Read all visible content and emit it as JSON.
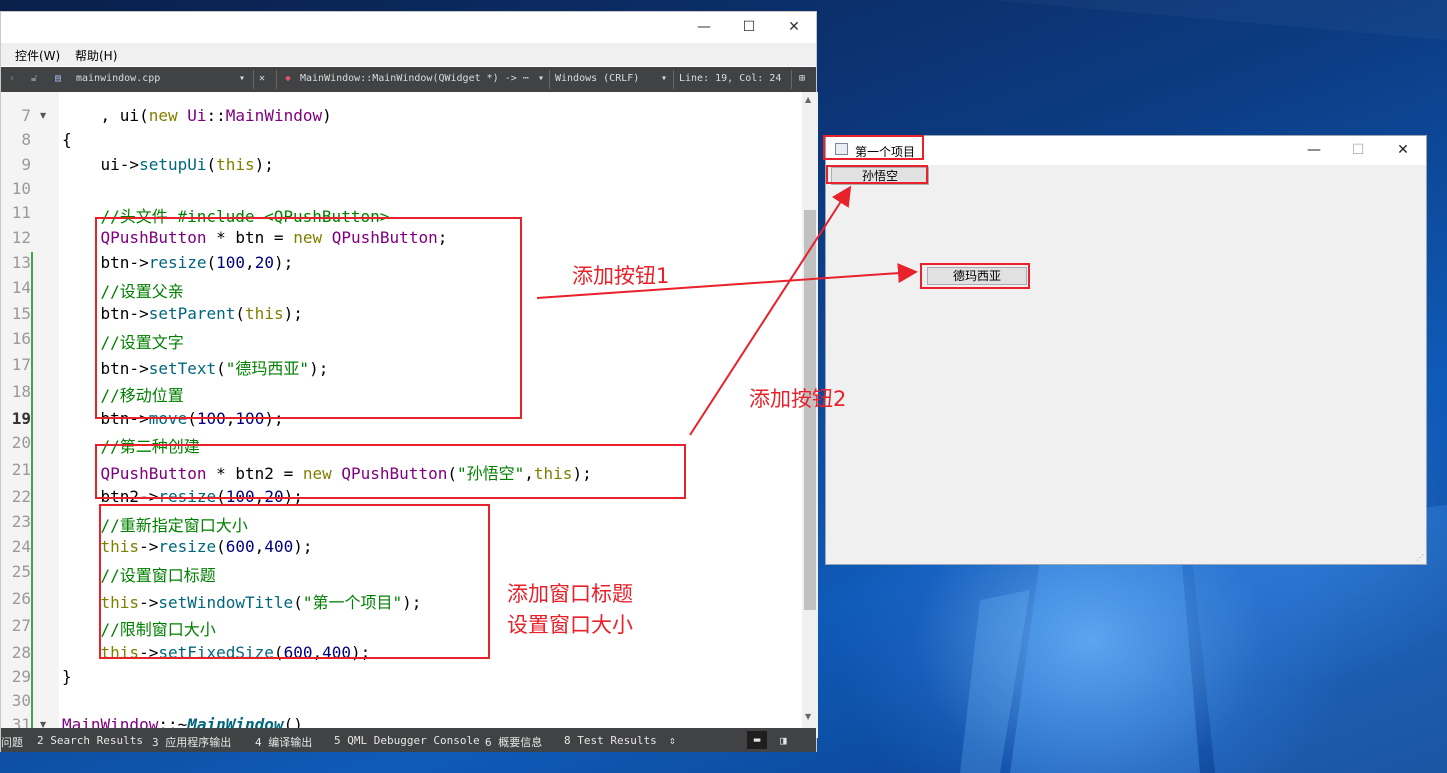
{
  "ide": {
    "window_controls": [
      "—",
      "☐",
      "✕"
    ],
    "menu": [
      "控件(W)",
      "帮助(H)"
    ],
    "toolbar": {
      "file": "mainwindow.cpp",
      "symbol": "MainWindow::MainWindow(QWidget *) -> ⋯",
      "encoding": "Windows (CRLF)",
      "position": "Line: 19, Col: 24"
    },
    "line_numbers": [
      "7",
      "8",
      "9",
      "10",
      "11",
      "12",
      "13",
      "14",
      "15",
      "16",
      "17",
      "18",
      "19",
      "20",
      "21",
      "22",
      "23",
      "24",
      "25",
      "26",
      "27",
      "28",
      "29",
      "30",
      "31"
    ],
    "current_line": "19",
    "status_items": [
      "问题",
      "2 Search Results",
      "3 应用程序输出",
      "4 编译输出",
      "5 QML Debugger Console",
      "6 概要信息",
      "8 Test Results"
    ]
  },
  "app": {
    "title": "第一个项目",
    "button1": "德玛西亚",
    "button2": "孙悟空"
  },
  "annotations": {
    "add_button1": "添加按钮1",
    "add_button2": "添加按钮2",
    "window_title_line1": "添加窗口标题",
    "window_title_line2": "设置窗口大小"
  },
  "colors": {
    "annotation_red": "#e8212a",
    "keyword": "#808000",
    "type": "#800080",
    "function": "#00677c",
    "number": "#000080",
    "comment": "#008000"
  }
}
